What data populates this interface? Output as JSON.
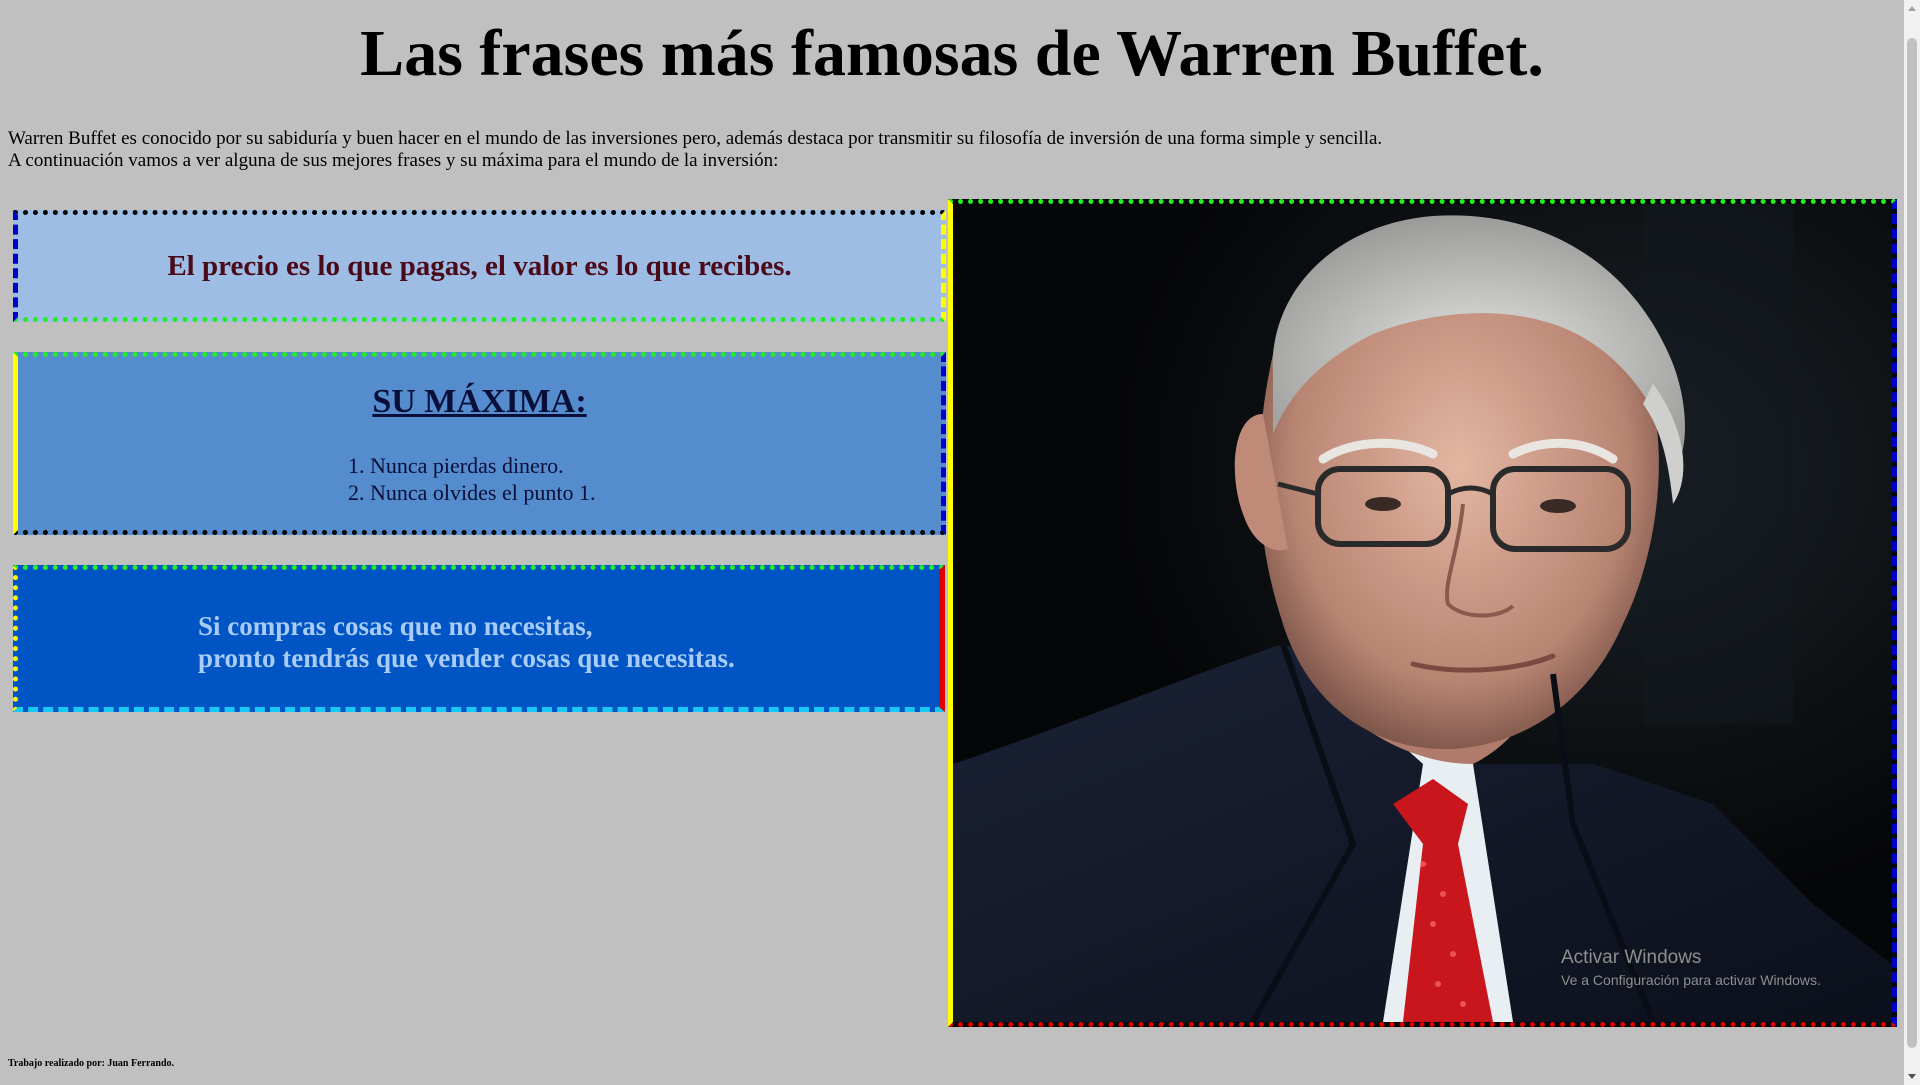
{
  "page": {
    "title": "Las frases más famosas de Warren Buffet.",
    "intro_line_1": "Warren Buffet es conocido por su sabiduría y buen hacer en el mundo de las inversiones pero, además destaca por transmitir su filosofía de inversión de una forma simple y sencilla.",
    "intro_line_2": "A continuación vamos a ver alguna de sus mejores frases y su máxima para el mundo de la inversión:"
  },
  "quote_box_1": {
    "text": "El precio es lo que pagas, el valor es lo que recibes."
  },
  "maxima_box": {
    "heading": "SU MÁXIMA:",
    "items": [
      "1. Nunca pierdas dinero.",
      "2. Nunca olvides el punto 1."
    ]
  },
  "quote_box_3": {
    "line_1": "Si compras cosas que no necesitas,",
    "line_2": "pronto tendrás que vender cosas que necesitas."
  },
  "photo": {
    "subject": "portrait of Warren Buffett"
  },
  "watermark": {
    "line_1": "Activar Windows",
    "line_2": "Ve a Configuración para activar Windows."
  },
  "footer": {
    "text": "Trabajo realizado por: Juan Ferrando."
  },
  "colors": {
    "background": "#c0c0c0",
    "box1_bg": "#9dbde5",
    "box2_bg": "#548ccd",
    "box3_bg": "#0054c3",
    "box1_text": "#4a0a1a",
    "box3_text": "#a8ccf6"
  }
}
